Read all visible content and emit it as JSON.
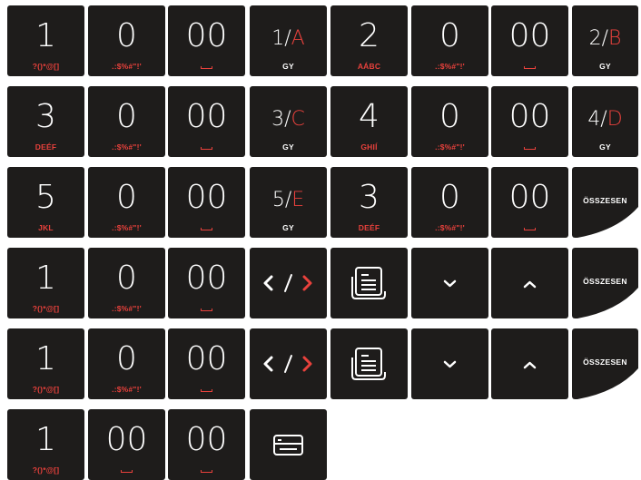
{
  "colors": {
    "key_bg": "#1e1c1b",
    "accent": "#e8413c",
    "text": "#ffffff"
  },
  "keys": {
    "r1": [
      {
        "main": "1",
        "sub": "?()*@[]"
      },
      {
        "main": "0",
        "sub": ".:$%#\"!'"
      },
      {
        "main": "00",
        "sub": "space-icon"
      },
      {
        "main_a": "1/",
        "main_b": "A",
        "sub": "GY"
      },
      {
        "main": "2",
        "sub": "AÁBC"
      },
      {
        "main": "0",
        "sub": ".:$%#\"!'"
      },
      {
        "main": "00",
        "sub": "space-icon"
      },
      {
        "main_a": "2/",
        "main_b": "B",
        "sub": "GY"
      }
    ],
    "r2": [
      {
        "main": "3",
        "sub": "DEÉF"
      },
      {
        "main": "0",
        "sub": ".:$%#\"!'"
      },
      {
        "main": "00",
        "sub": "space-icon"
      },
      {
        "main_a": "3/",
        "main_b": "C",
        "sub": "GY"
      },
      {
        "main": "4",
        "sub": "GHIÍ"
      },
      {
        "main": "0",
        "sub": ".:$%#\"!'"
      },
      {
        "main": "00",
        "sub": "space-icon"
      },
      {
        "main_a": "4/",
        "main_b": "D",
        "sub": "GY"
      }
    ],
    "r3": [
      {
        "main": "5",
        "sub": "JKL"
      },
      {
        "main": "0",
        "sub": ".:$%#\"!'"
      },
      {
        "main": "00",
        "sub": "space-icon"
      },
      {
        "main_a": "5/",
        "main_b": "E",
        "sub": "GY"
      },
      {
        "main": "3",
        "sub": "DEÉF"
      },
      {
        "main": "0",
        "sub": ".:$%#\"!'"
      },
      {
        "main": "00",
        "sub": "space-icon"
      },
      {
        "label": "ÖSSZESEN"
      }
    ],
    "r4": [
      {
        "main": "1",
        "sub": "?()*@[]"
      },
      {
        "main": "0",
        "sub": ".:$%#\"!'"
      },
      {
        "main": "00",
        "sub": "space-icon"
      },
      {
        "icon": "code-arrows-icon"
      },
      {
        "icon": "receipt-icon"
      },
      {
        "icon": "chevron-down-icon"
      },
      {
        "icon": "chevron-up-icon"
      },
      {
        "label": "ÖSSZESEN"
      }
    ],
    "r5": [
      {
        "main": "1",
        "sub": "?()*@[]"
      },
      {
        "main": "0",
        "sub": ".:$%#\"!'"
      },
      {
        "main": "00",
        "sub": "space-icon"
      },
      {
        "icon": "code-arrows-icon"
      },
      {
        "icon": "receipt-icon"
      },
      {
        "icon": "chevron-down-icon"
      },
      {
        "icon": "chevron-up-icon"
      },
      {
        "label": "ÖSSZESEN"
      }
    ],
    "r6": [
      {
        "main": "1",
        "sub": "?()*@[]"
      },
      {
        "main": "00",
        "sub": "space-icon"
      },
      {
        "main": "00",
        "sub": "space-icon"
      },
      {
        "icon": "card-icon"
      }
    ]
  }
}
